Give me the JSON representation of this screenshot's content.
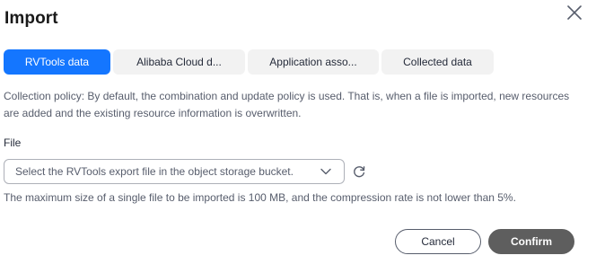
{
  "dialog": {
    "title": "Import",
    "close_icon": "close-icon"
  },
  "tabs": [
    {
      "label": "RVTools data",
      "active": true
    },
    {
      "label": "Alibaba Cloud d...",
      "active": false
    },
    {
      "label": "Application asso...",
      "active": false
    },
    {
      "label": "Collected data",
      "active": false
    }
  ],
  "policy_text": "Collection policy: By default, the combination and update policy is used. That is, when a file is imported, new resources are added and the existing resource information is overwritten.",
  "file": {
    "label": "File",
    "placeholder": "Select the RVTools export file in the object storage bucket.",
    "dropdown_icon": "chevron-down-icon",
    "refresh_icon": "refresh-icon"
  },
  "hint": "The maximum size of a single file to be imported is 100 MB, and the compression rate is not lower than 5%.",
  "buttons": {
    "cancel": "Cancel",
    "confirm": "Confirm"
  },
  "colors": {
    "active_tab": "#1476ff",
    "confirm_button": "#5e5e5e"
  }
}
